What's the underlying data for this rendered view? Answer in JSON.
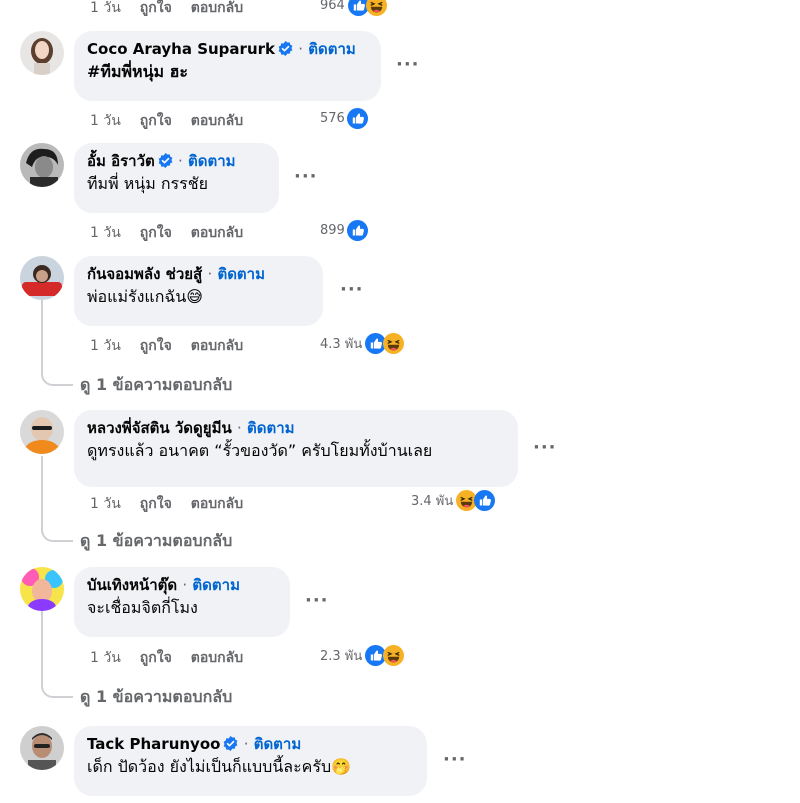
{
  "follow_label": "ติดตาม",
  "separator": "·",
  "more_label": "···",
  "reply_label": "ตอบกลับ",
  "like_label": "ถูกใจ",
  "comments": [
    {
      "time": "1 วัน",
      "reaction_count": "964",
      "reactions": [
        "like-icon",
        "haha-icon"
      ]
    },
    {
      "name": "Coco Arayha Suparurk",
      "verified": true,
      "text": "#ทีมพี่หนุ่ม ฮะ",
      "time": "1 วัน",
      "reaction_count": "576",
      "reactions": [
        "like-icon"
      ]
    },
    {
      "name": "อั้ม อิราวัต",
      "verified": true,
      "text": "ทีมพี่ หนุ่ม กรรชัย",
      "time": "1 วัน",
      "reaction_count": "899",
      "reactions": [
        "like-icon"
      ]
    },
    {
      "name": "กันจอมพลัง ช่วยสู้",
      "verified": false,
      "text": "พ่อแม่รังแกฉัน😅",
      "time": "1 วัน",
      "reaction_count": "4.3 พัน",
      "reactions": [
        "like-icon",
        "haha-icon"
      ],
      "replies": "ดู 1 ข้อความตอบกลับ"
    },
    {
      "name": "หลวงพี่จัสติน วัดดูยูมีน",
      "verified": false,
      "text": "ดูทรงแล้ว อนาคต “รั้วของวัด” ครับโยมทั้งบ้านเลย",
      "time": "1 วัน",
      "reaction_count": "3.4 พัน",
      "reactions": [
        "haha-icon",
        "like-icon"
      ],
      "replies": "ดู 1 ข้อความตอบกลับ"
    },
    {
      "name": "บันเทิงหน้าตุ๊ด",
      "verified": false,
      "text": "จะเชื่อมจิตกี่โมง",
      "time": "1 วัน",
      "reaction_count": "2.3 พัน",
      "reactions": [
        "like-icon",
        "haha-icon"
      ],
      "replies": "ดู 1 ข้อความตอบกลับ"
    },
    {
      "name": "Tack Pharunyoo",
      "verified": true,
      "text": "เด็ก ปัดว้อง ยังไม่เป็นก็แบบนี้ละครับ🤭"
    }
  ],
  "colors": {
    "bubble": "#f0f2f5",
    "follow": "#0064d1",
    "meta": "#65676b",
    "like": "#1877f2",
    "haha": "#f7b125"
  }
}
